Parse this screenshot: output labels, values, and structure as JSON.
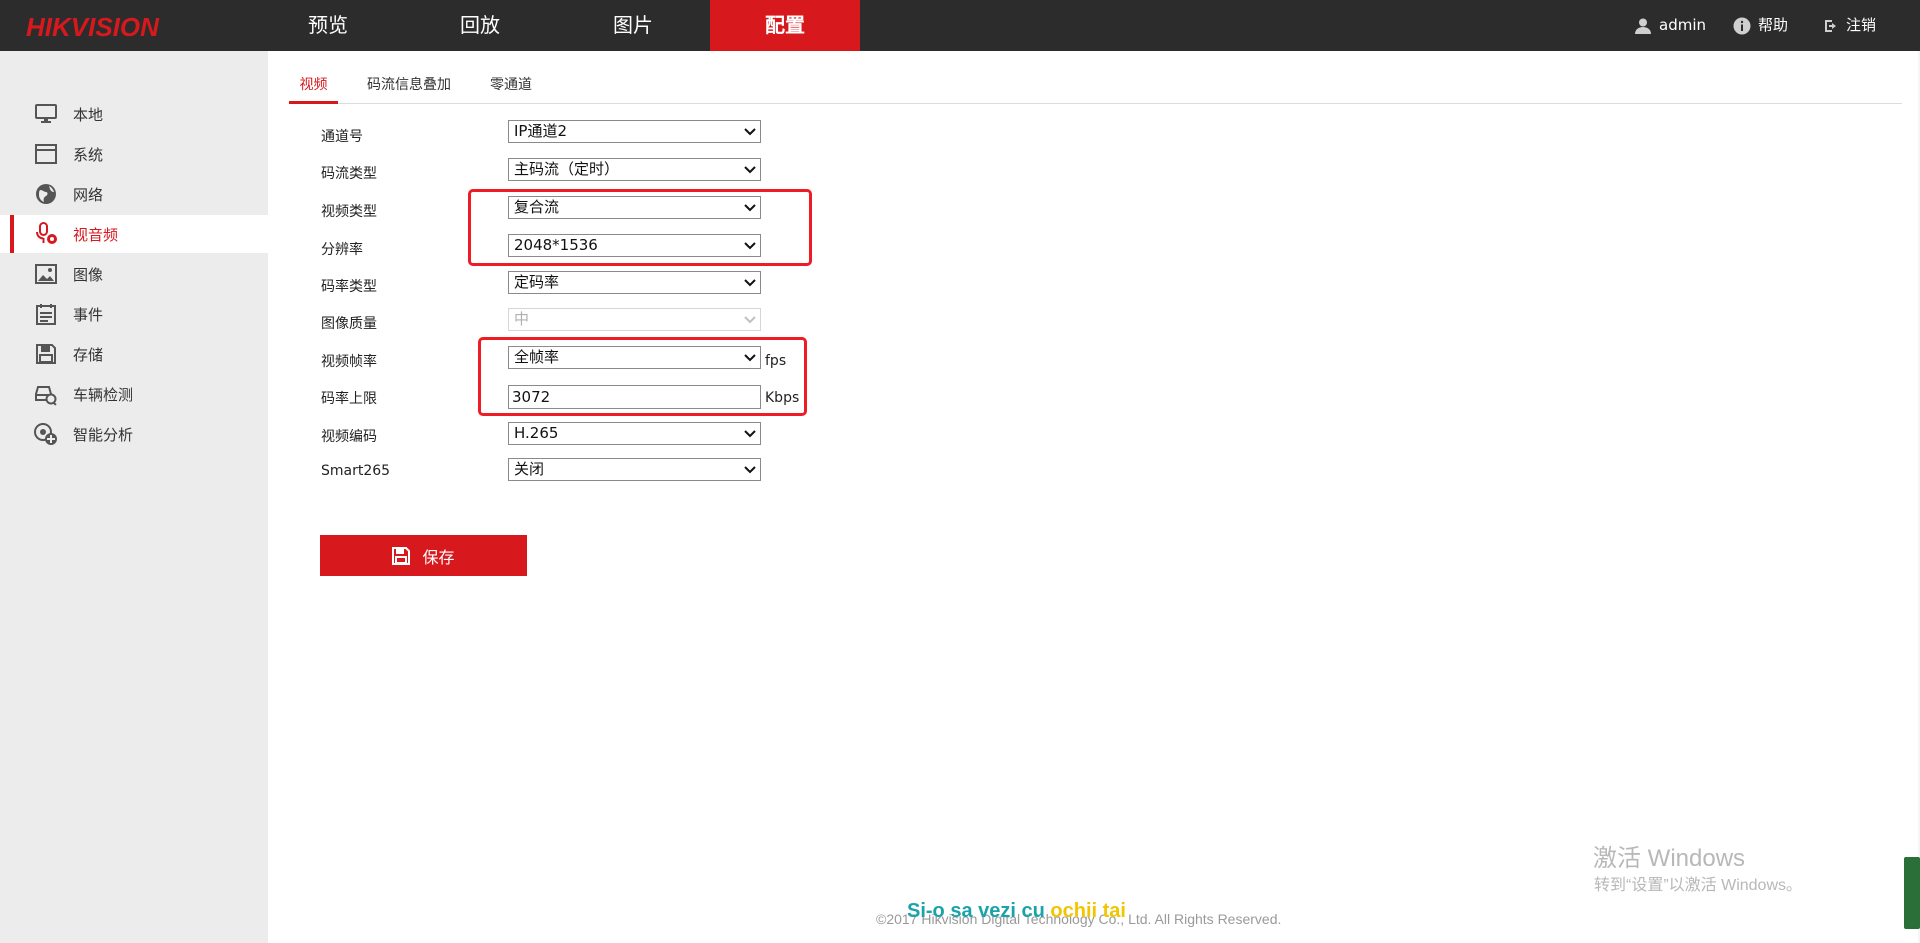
{
  "app": {
    "logo_text": "HIKVISION",
    "brand_color": "#d7191e"
  },
  "topnav": {
    "items": [
      {
        "label": "预览"
      },
      {
        "label": "回放"
      },
      {
        "label": "图片"
      },
      {
        "label": "配置",
        "active": true
      }
    ],
    "user": "admin",
    "help": "帮助",
    "logout": "注销"
  },
  "sidebar": {
    "items": [
      {
        "label": "本地",
        "icon": "monitor-icon"
      },
      {
        "label": "系统",
        "icon": "system-window-icon"
      },
      {
        "label": "网络",
        "icon": "globe-icon"
      },
      {
        "label": "视音频",
        "icon": "microphone-icon",
        "active": true
      },
      {
        "label": "图像",
        "icon": "image-icon"
      },
      {
        "label": "事件",
        "icon": "event-list-icon"
      },
      {
        "label": "存储",
        "icon": "storage-disk-icon"
      },
      {
        "label": "车辆检测",
        "icon": "vehicle-detect-icon"
      },
      {
        "label": "智能分析",
        "icon": "smart-analysis-icon"
      }
    ]
  },
  "tabs": [
    {
      "label": "视频",
      "active": true
    },
    {
      "label": "码流信息叠加"
    },
    {
      "label": "零通道"
    }
  ],
  "form": {
    "channel": {
      "label": "通道号",
      "value": "IP通道2"
    },
    "stream_type": {
      "label": "码流类型",
      "value": "主码流（定时）"
    },
    "video_type": {
      "label": "视频类型",
      "value": "复合流"
    },
    "resolution": {
      "label": "分辨率",
      "value": "2048*1536"
    },
    "bitrate_type": {
      "label": "码率类型",
      "value": "定码率"
    },
    "image_quality": {
      "label": "图像质量",
      "value": "中",
      "disabled": true
    },
    "frame_rate": {
      "label": "视频帧率",
      "value": "全帧率",
      "unit": "fps"
    },
    "max_bitrate": {
      "label": "码率上限",
      "value": "3072",
      "unit": "Kbps"
    },
    "video_encoding": {
      "label": "视频编码",
      "value": "H.265"
    },
    "smart265": {
      "label": "Smart265",
      "value": "关闭"
    }
  },
  "save_label": "保存",
  "footer": "©2017 Hikvision Digital Technology Co., Ltd. All Rights Reserved.",
  "watermark": {
    "line1": "激活 Windows",
    "line2": "转到“设置”以激活 Windows。"
  },
  "overlay_caption": {
    "part1": "Si-o sa vezi cu ",
    "part2": "ochii",
    "part3": " tai"
  },
  "colors": {
    "highlight": "#ee1c25",
    "topbar": "#2c2c2c",
    "sidebar": "#ececec"
  }
}
